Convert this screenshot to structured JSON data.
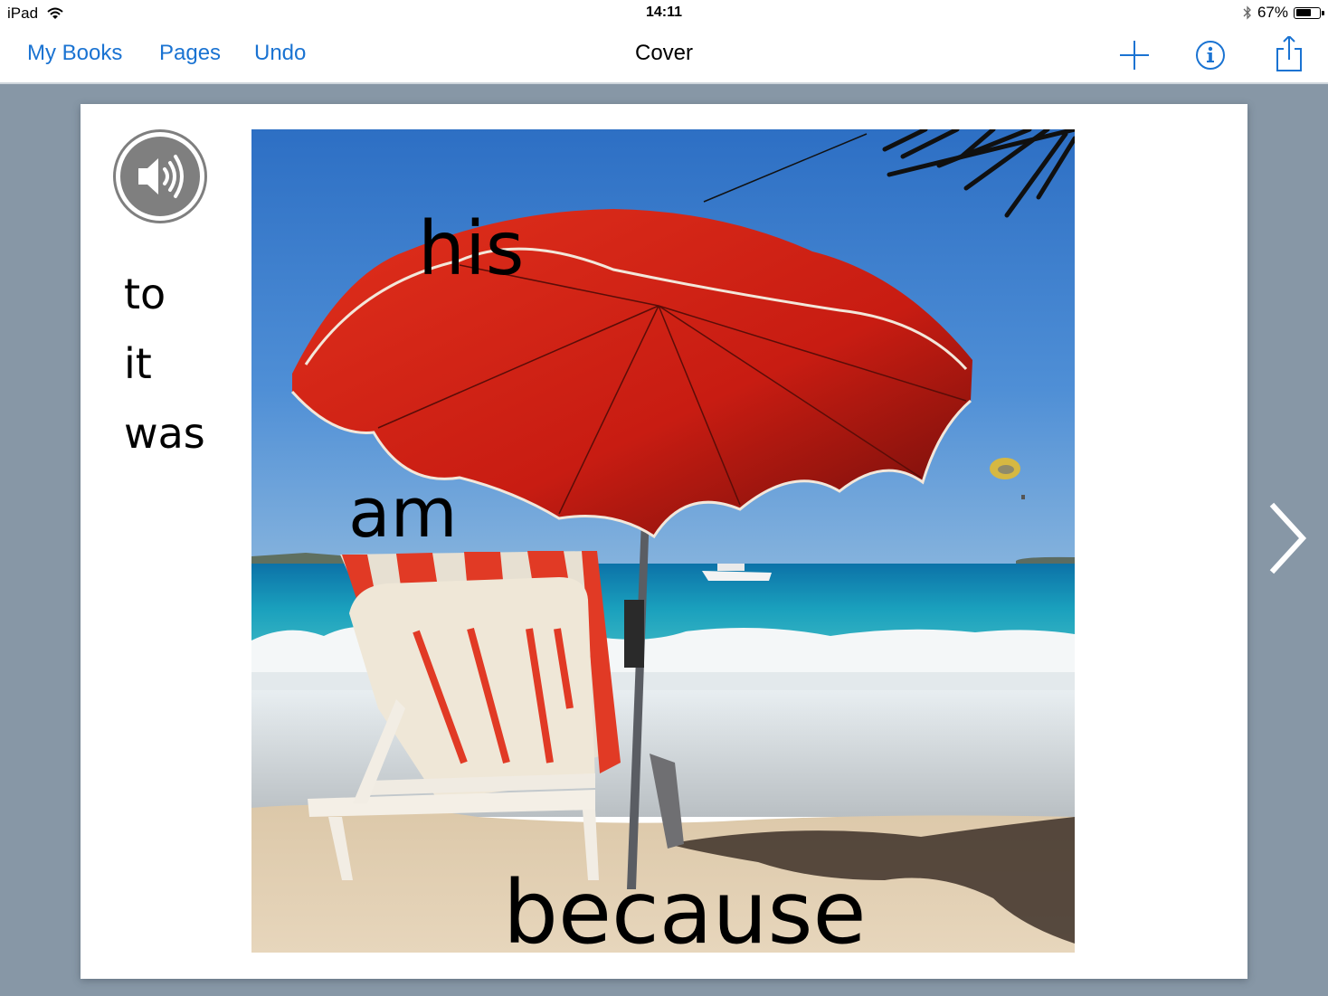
{
  "status_bar": {
    "device": "iPad",
    "time": "14:11",
    "battery_percent": "67%",
    "battery_level": 0.67,
    "icons": [
      "wifi-icon",
      "bluetooth-icon",
      "battery-icon"
    ]
  },
  "nav": {
    "my_books_label": "My Books",
    "pages_label": "Pages",
    "undo_label": "Undo",
    "title": "Cover",
    "icons": [
      "add-icon",
      "info-icon",
      "share-icon"
    ],
    "accent_color": "#1a73d2"
  },
  "page": {
    "sound_button_icon": "speaker-icon",
    "side_words": [
      "to",
      "it",
      "was"
    ],
    "photo_description": "Red beach umbrella over striped lounge chair on sandy beach with turquoise sea",
    "photo_words": {
      "his": "his",
      "am": "am",
      "because": "because"
    }
  },
  "next_page_icon": "chevron-right-icon",
  "colors": {
    "background": "#8797a6",
    "page": "#ffffff",
    "speaker_gray": "#7f7f7f"
  }
}
